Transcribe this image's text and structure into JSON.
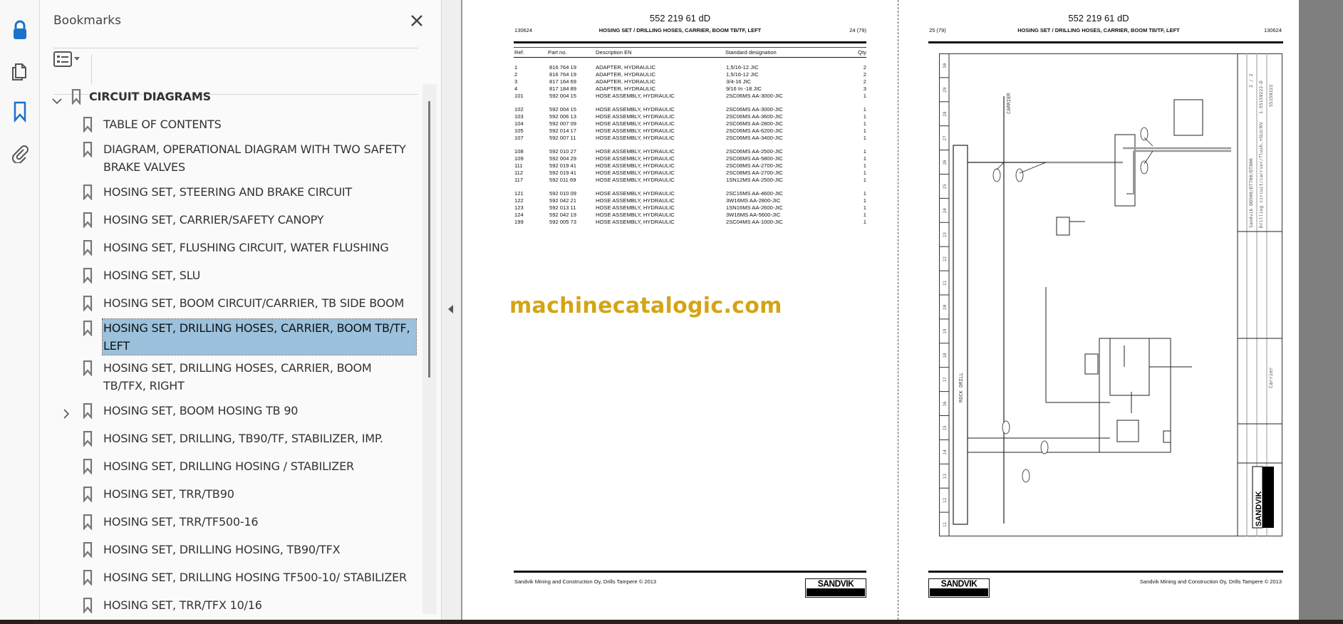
{
  "panel": {
    "title": "Bookmarks",
    "bookmarks": [
      {
        "label": "CIRCUIT DIAGRAMS",
        "level": 0,
        "expanded": true
      },
      {
        "label": "TABLE OF CONTENTS"
      },
      {
        "label": "DIAGRAM, OPERATIONAL DIAGRAM WITH TWO SAFETY BRAKE VALVES"
      },
      {
        "label": "HOSING SET, STEERING AND BRAKE CIRCUIT"
      },
      {
        "label": "HOSING SET, CARRIER/SAFETY CANOPY"
      },
      {
        "label": "HOSING SET, FLUSHING CIRCUIT, WATER FLUSHING"
      },
      {
        "label": "HOSING SET, SLU"
      },
      {
        "label": "HOSING SET, BOOM CIRCUIT/CARRIER, TB SIDE BOOM"
      },
      {
        "label": "HOSING SET, DRILLING HOSES, CARRIER, BOOM TB/TF, LEFT",
        "selected": true
      },
      {
        "label": "HOSING SET, DRILLING HOSES, CARRIER,  BOOM TB/TFX, RIGHT"
      },
      {
        "label": "HOSING SET, BOOM HOSING TB 90",
        "collapsed": true
      },
      {
        "label": "HOSING SET, DRILLING, TB90/TF, STABILIZER, IMP."
      },
      {
        "label": "HOSING SET, DRILLING HOSING / STABILIZER"
      },
      {
        "label": "HOSING SET, TRR/TB90"
      },
      {
        "label": "HOSING SET, TRR/TF500-16"
      },
      {
        "label": "HOSING SET, DRILLING HOSING, TB90/TFX"
      },
      {
        "label": "HOSING SET, DRILLING HOSING TF500-10/ STABILIZER"
      },
      {
        "label": "HOSING SET, TRR/TFX 10/16"
      }
    ]
  },
  "colors": {
    "accent": "#1a73c8",
    "selection": "#9bc1dc",
    "watermark": "#d4a514"
  },
  "page_left": {
    "doc_number": "552 219 61 dD",
    "date_code": "130624",
    "title": "HOSING SET / DRILLING HOSES, CARRIER, BOOM TB/TF, LEFT",
    "page": "24 (79)",
    "columns": {
      "ref": "Ref.",
      "part": "Part no.",
      "desc": "Description EN",
      "std": "Standard designation",
      "qty": "Qty"
    },
    "rows": [
      {
        "ref": "1",
        "part": "816 764 19",
        "desc": "ADAPTER, HYDRAULIC",
        "std": "1,5/16-12 JIC",
        "qty": "2"
      },
      {
        "ref": "2",
        "part": "816 764 19",
        "desc": "ADAPTER, HYDRAULIC",
        "std": "1,5/16-12 JIC",
        "qty": "2"
      },
      {
        "ref": "3",
        "part": "817 164 69",
        "desc": "ADAPTER, HYDRAULIC",
        "std": "3/4-16 JIC",
        "qty": "2"
      },
      {
        "ref": "4",
        "part": "817 184 89",
        "desc": "ADAPTER, HYDRAULIC",
        "std": "9/16 In -18 JIC",
        "qty": "3"
      },
      {
        "ref": "101",
        "part": "592 004 15",
        "desc": "HOSE ASSEMBLY, HYDRAULIC",
        "std": "2SC06MS AA-3000-JIC",
        "qty": "1",
        "gap_after": true
      },
      {
        "ref": "102",
        "part": "592 004 15",
        "desc": "HOSE ASSEMBLY, HYDRAULIC",
        "std": "2SC06MS AA-3000-JIC",
        "qty": "1"
      },
      {
        "ref": "103",
        "part": "592 006 13",
        "desc": "HOSE ASSEMBLY, HYDRAULIC",
        "std": "2SC06MS AA-3600-JIC",
        "qty": "1"
      },
      {
        "ref": "104",
        "part": "592 007 09",
        "desc": "HOSE ASSEMBLY, HYDRAULIC",
        "std": "2SC06MS AA-2800-JIC",
        "qty": "1"
      },
      {
        "ref": "105",
        "part": "592 014 17",
        "desc": "HOSE ASSEMBLY, HYDRAULIC",
        "std": "2SC06MS AA-6200-JIC",
        "qty": "1"
      },
      {
        "ref": "107",
        "part": "592 007 11",
        "desc": "HOSE ASSEMBLY, HYDRAULIC",
        "std": "2SC06MS AA-3400-JIC",
        "qty": "1",
        "gap_after": true
      },
      {
        "ref": "108",
        "part": "592 010 27",
        "desc": "HOSE ASSEMBLY, HYDRAULIC",
        "std": "2SC06MS AA-2500-JIC",
        "qty": "1"
      },
      {
        "ref": "109",
        "part": "592 004 29",
        "desc": "HOSE ASSEMBLY, HYDRAULIC",
        "std": "2SC06MS AA-5800-JIC",
        "qty": "1"
      },
      {
        "ref": "111",
        "part": "592 019 41",
        "desc": "HOSE ASSEMBLY, HYDRAULIC",
        "std": "2SC08MS AA-2700-JIC",
        "qty": "1"
      },
      {
        "ref": "112",
        "part": "592 019 41",
        "desc": "HOSE ASSEMBLY, HYDRAULIC",
        "std": "2SC08MS AA-2700-JIC",
        "qty": "1"
      },
      {
        "ref": "117",
        "part": "592 011 69",
        "desc": "HOSE ASSEMBLY, HYDRAULIC",
        "std": "1SN12MS AA-2500-JIC",
        "qty": "1",
        "gap_after": true
      },
      {
        "ref": "121",
        "part": "592 010 09",
        "desc": "HOSE ASSEMBLY, HYDRAULIC",
        "std": "2SC16MS AA-4600-JIC",
        "qty": "1"
      },
      {
        "ref": "122",
        "part": "592 042 21",
        "desc": "HOSE ASSEMBLY, HYDRAULIC",
        "std": "3W16MS AA-2800-JIC",
        "qty": "1"
      },
      {
        "ref": "123",
        "part": "592 013 11",
        "desc": "HOSE ASSEMBLY, HYDRAULIC",
        "std": "1SN16MS AA-2600-JIC",
        "qty": "1"
      },
      {
        "ref": "124",
        "part": "592 042 19",
        "desc": "HOSE ASSEMBLY, HYDRAULIC",
        "std": "3W16MS AA-5600-JIC",
        "qty": "1"
      },
      {
        "ref": "199",
        "part": "592 005 73",
        "desc": "HOSE ASSEMBLY, HYDRAULIC",
        "std": "2SC04MS AA-1000-JIC",
        "qty": "1"
      }
    ],
    "footer": "Sandvik Mining and Construction Oy, Drills Tampere © 2013",
    "logo": "SANDVIK"
  },
  "page_right": {
    "doc_number": "552 219 61 dD",
    "page": "25 (79)",
    "title": "HOSING SET / DRILLING HOSES, CARRIER, BOOM TB/TF, LEFT",
    "date_code": "130624",
    "diagram": {
      "carrier_label": "CARRIER",
      "rock_drill_label": "ROCK DRILL",
      "title_block_line1": "Sandvik DD500/DT700/DT800",
      "title_block_line2": "Drilling circuit/carrier/flush.+SLU/KV",
      "sheet": "2 / 2",
      "drawing_no": "1-55159222-D",
      "code": "55159222",
      "section": "Carrier",
      "logo": "SANDVIK"
    },
    "footer": "Sandvik Mining and Construction Oy, Drills Tampere © 2013",
    "logo": "SANDVIK"
  },
  "watermark": "machinecatalogic.com"
}
